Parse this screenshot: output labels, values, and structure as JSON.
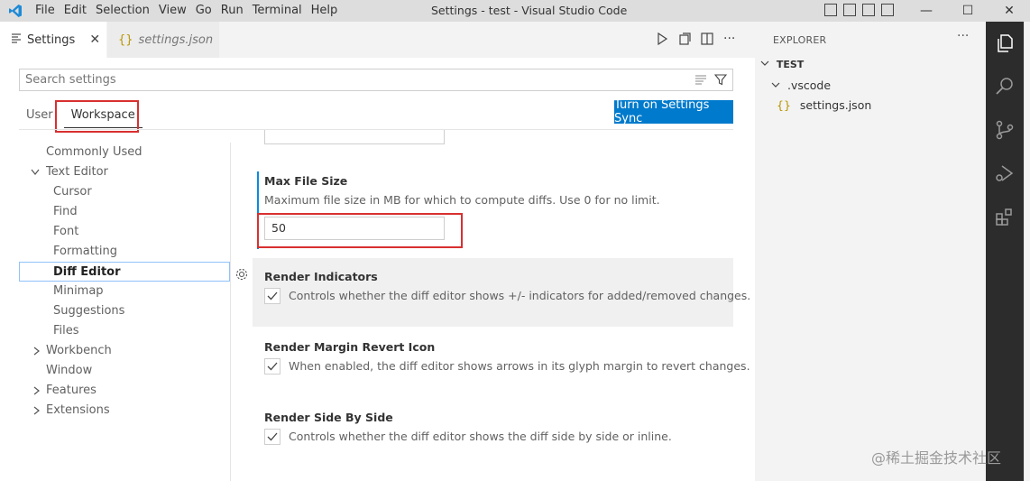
{
  "titlebar": {
    "menu": [
      "File",
      "Edit",
      "Selection",
      "View",
      "Go",
      "Run",
      "Terminal",
      "Help"
    ],
    "window_title": "Settings - test - Visual Studio Code",
    "minimize": "—",
    "maximize": "☐",
    "close": "✕"
  },
  "tabs": [
    {
      "label": "Settings",
      "icon": "settings-lines-icon",
      "close": "✕"
    },
    {
      "label": "settings.json",
      "icon": "json-braces-icon"
    }
  ],
  "settings_editor": {
    "search_placeholder": "Search settings",
    "scope_tabs": [
      "User",
      "Workspace"
    ],
    "selected_scope": "Workspace",
    "sync_button": "Turn on Settings Sync",
    "toc": [
      {
        "label": "Commonly Used",
        "level": 0,
        "chevron": ""
      },
      {
        "label": "Text Editor",
        "level": 0,
        "chevron": "down"
      },
      {
        "label": "Cursor",
        "level": 1,
        "chevron": ""
      },
      {
        "label": "Find",
        "level": 1,
        "chevron": ""
      },
      {
        "label": "Font",
        "level": 1,
        "chevron": ""
      },
      {
        "label": "Formatting",
        "level": 1,
        "chevron": ""
      },
      {
        "label": "Diff Editor",
        "level": 1,
        "chevron": "",
        "selected": true
      },
      {
        "label": "Minimap",
        "level": 1,
        "chevron": ""
      },
      {
        "label": "Suggestions",
        "level": 1,
        "chevron": ""
      },
      {
        "label": "Files",
        "level": 1,
        "chevron": ""
      },
      {
        "label": "Workbench",
        "level": 0,
        "chevron": "right"
      },
      {
        "label": "Window",
        "level": 0,
        "chevron": ""
      },
      {
        "label": "Features",
        "level": 0,
        "chevron": "right"
      },
      {
        "label": "Extensions",
        "level": 0,
        "chevron": "right"
      }
    ],
    "settings": [
      {
        "title": "Max File Size",
        "description": "Maximum file size in MB for which to compute diffs. Use 0 for no limit.",
        "value": "50",
        "modified": true
      },
      {
        "title": "Render Indicators",
        "description": "Controls whether the diff editor shows +/- indicators for added/removed changes.",
        "checked": true
      },
      {
        "title": "Render Margin Revert Icon",
        "description": "When enabled, the diff editor shows arrows in its glyph margin to revert changes.",
        "checked": true
      },
      {
        "title": "Render Side By Side",
        "description": "Controls whether the diff editor shows the diff side by side or inline.",
        "checked": true
      }
    ]
  },
  "explorer": {
    "header": "EXPLORER",
    "more": "···",
    "folder": "TEST",
    "subfolder": ".vscode",
    "file": "settings.json",
    "file_icon_text": "{}"
  },
  "watermark": "@稀土掘金技术社区",
  "colors": {
    "accent": "#007acc",
    "highlight_red": "#d93030",
    "activity_bar": "#2c2c2c",
    "modified_indicator": "#0b8be0"
  }
}
